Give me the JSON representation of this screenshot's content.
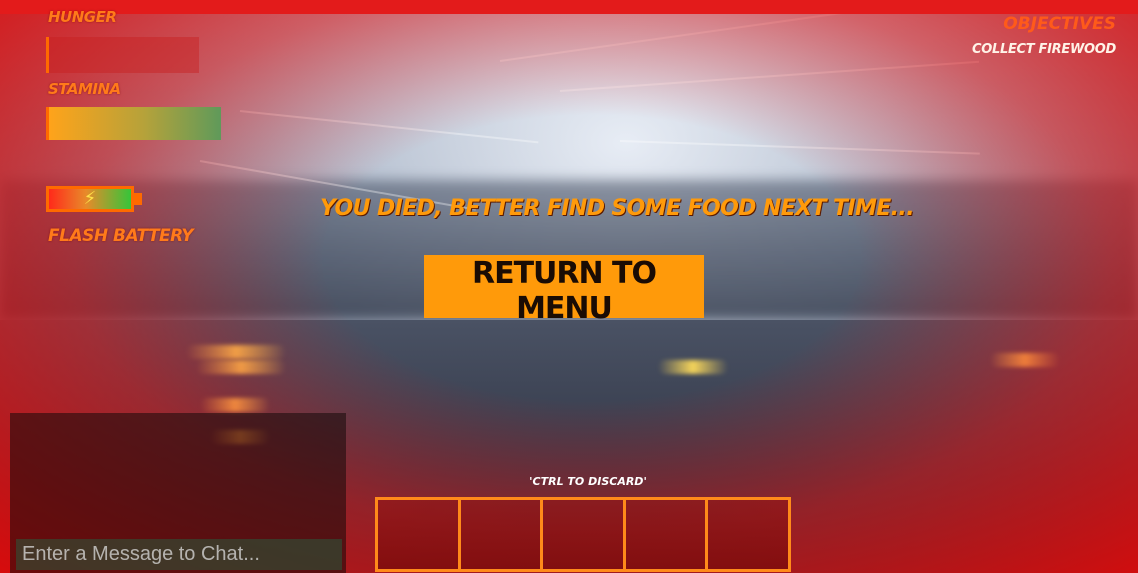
{
  "hud": {
    "hunger_label": "HUNGER",
    "stamina_label": "STAMINA",
    "stamina_level": 1.0,
    "battery_label": "FLASH BATTERY",
    "battery_icon": "lightning-bolt-icon"
  },
  "objectives": {
    "title": "OBJECTIVES",
    "items": [
      "COLLECT FIREWOOD"
    ]
  },
  "death_screen": {
    "message": "YOU DIED, BETTER FIND SOME FOOD NEXT TIME...",
    "return_button": "RETURN TO MENU"
  },
  "chat": {
    "placeholder": "Enter a Message to Chat..."
  },
  "inventory": {
    "hint": "'CTRL TO DISCARD'",
    "slot_count": 5
  },
  "colors": {
    "accent": "#ff9a0a",
    "vignette": "#e31b1b"
  }
}
